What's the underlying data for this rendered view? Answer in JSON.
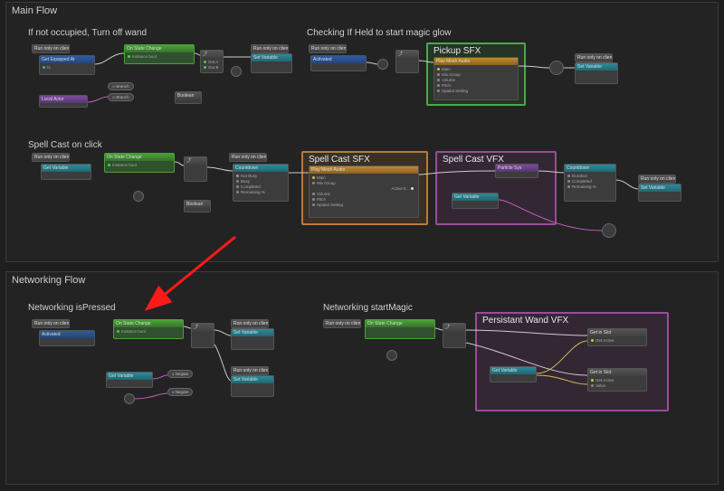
{
  "sections": {
    "main": {
      "title": "Main Flow"
    },
    "net": {
      "title": "Networking Flow"
    }
  },
  "subtitles": {
    "turnoff": "If not occupied, Turn off wand",
    "checkheld": "Checking If Held to start magic glow",
    "spellclick": "Spell Cast on click",
    "netpress": "Networking isPressed",
    "netmagic": "Networking startMagic"
  },
  "groups": {
    "pickup": "Pickup SFX",
    "castsfx": "Spell Cast SFX",
    "castvfx": "Spell Cast VFX",
    "wandvfx": "Persistant Wand VFX"
  },
  "node_labels": {
    "runonclients": "Run only on client x",
    "onstate": "On State Change",
    "instancebool": "Instance bool",
    "branch": "Branch",
    "boolean": "Boolean",
    "getvar": "Get Variable",
    "setvar": "Set Variable",
    "countdown": "Countdown",
    "playmesh": "Play Mesh Audio",
    "getequipped": "Get Equipped At",
    "localactor": "Local Actor",
    "activated": "Activated",
    "negate": "Negate",
    "particle": "Particle Sys",
    "getslot": "Get in Slot",
    "getactive": "Get Active",
    "value": "Value",
    "notbusy": "Not Busy",
    "busy": "Busy",
    "completed": "Completed",
    "remaining": "Remaining %",
    "duration": "Duration",
    "activeevent": "Active E...",
    "main": "Main",
    "mixgroup": "Mix Group",
    "volume": "Volume",
    "pitch": "Pitch",
    "spatial": "Spatial Setting",
    "is": "Is",
    "outa": "Out A",
    "outb": "Out B"
  },
  "annotation": {
    "arrow_target": "Networking isPressed"
  }
}
